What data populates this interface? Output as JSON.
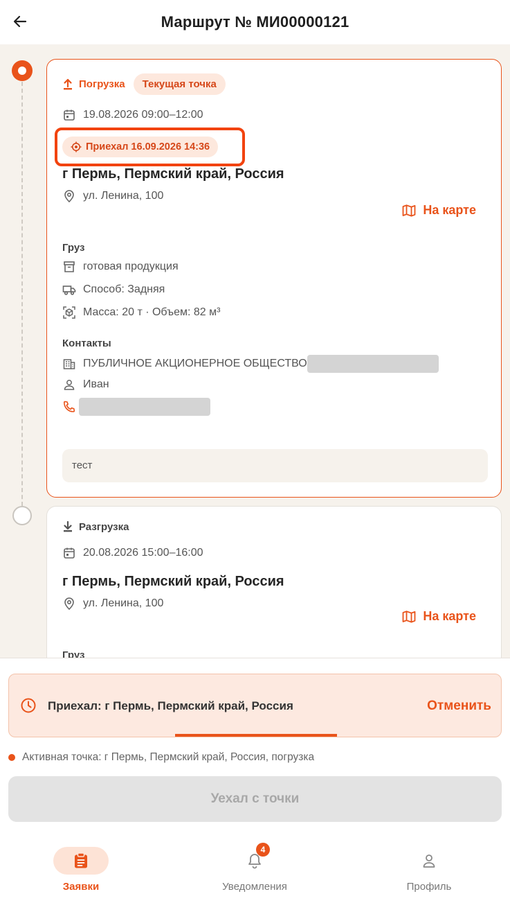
{
  "header": {
    "title": "Маршрут № МИ00000121"
  },
  "stops": [
    {
      "type_label": "Погрузка",
      "current_badge": "Текущая точка",
      "date": "19.08.2026 09:00–12:00",
      "arrived": "Приехал 16.09.2026 14:36",
      "city": "г Пермь, Пермский край, Россия",
      "address": "ул. Ленина, 100",
      "map_link": "На карте",
      "cargo_title": "Груз",
      "cargo_name": "готовая продукция",
      "cargo_method": "Способ: Задняя",
      "cargo_mass": "Масса: 20 т · Объем: 82 м³",
      "contacts_title": "Контакты",
      "company": "ПУБЛИЧНОЕ АКЦИОНЕРНОЕ ОБЩЕСТВО",
      "person": "Иван",
      "comment": "тест"
    },
    {
      "type_label": "Разгрузка",
      "date": "20.08.2026 15:00–16:00",
      "city": "г Пермь, Пермский край, Россия",
      "address": "ул. Ленина, 100",
      "map_link": "На карте",
      "cargo_title": "Груз"
    }
  ],
  "status_banner": {
    "text": "Приехал: г Пермь, Пермский край, Россия",
    "cancel_label": "Отменить"
  },
  "active_point": "Активная точка: г Пермь, Пермский край, Россия, погрузка",
  "leave_button": "Уехал с точки",
  "nav": {
    "items": [
      {
        "label": "Заявки",
        "icon": "clipboard-icon",
        "active": true
      },
      {
        "label": "Уведомления",
        "icon": "bell-icon",
        "badge": "4"
      },
      {
        "label": "Профиль",
        "icon": "person-icon"
      }
    ]
  },
  "colors": {
    "accent": "#e9531a",
    "background": "#f6f2ec",
    "highlight": "#f2430e"
  }
}
